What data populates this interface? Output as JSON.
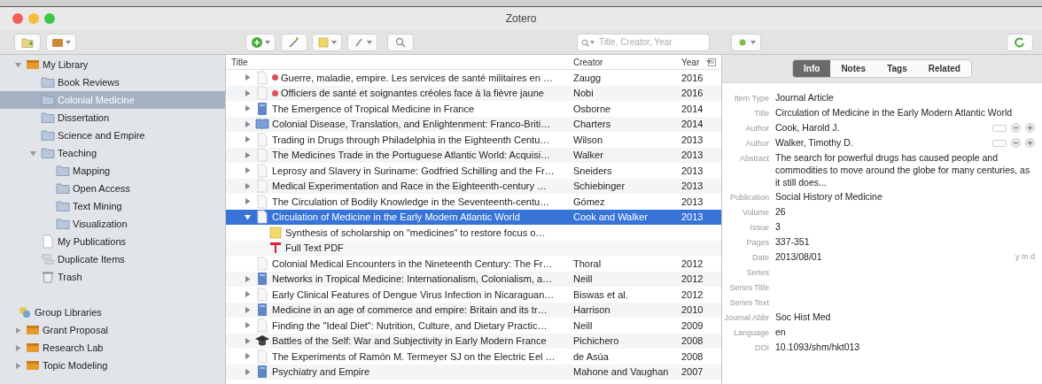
{
  "window": {
    "title": "Zotero"
  },
  "toolbar": {
    "search": {
      "placeholder": "Title, Creator, Year"
    }
  },
  "collections": [
    {
      "label": "My Library",
      "kind": "library",
      "expanded": true,
      "selected": false,
      "children": [
        {
          "label": "Book Reviews",
          "kind": "folder",
          "selected": false
        },
        {
          "label": "Colonial Medicine",
          "kind": "folder",
          "selected": true
        },
        {
          "label": "Dissertation",
          "kind": "folder",
          "selected": false
        },
        {
          "label": "Science and Empire",
          "kind": "folder",
          "selected": false
        },
        {
          "label": "Teaching",
          "kind": "folder",
          "selected": false,
          "expanded": true,
          "children": [
            {
              "label": "Mapping",
              "kind": "folder",
              "selected": false
            },
            {
              "label": "Open Access",
              "kind": "folder",
              "selected": false
            },
            {
              "label": "Text Mining",
              "kind": "folder",
              "selected": false
            },
            {
              "label": "Visualization",
              "kind": "folder",
              "selected": false
            }
          ]
        },
        {
          "label": "My Publications",
          "kind": "publications",
          "selected": false
        },
        {
          "label": "Duplicate Items",
          "kind": "duplicates",
          "selected": false
        },
        {
          "label": "Trash",
          "kind": "trash",
          "selected": false
        }
      ]
    }
  ],
  "group_libraries": {
    "label": "Group Libraries",
    "groups": [
      {
        "label": "Grant Proposal",
        "expanded": false
      },
      {
        "label": "Research Lab",
        "expanded": false
      },
      {
        "label": "Topic Modeling",
        "expanded": false
      }
    ]
  },
  "items_table": {
    "columns": [
      {
        "label": "Title",
        "sorted": false
      },
      {
        "label": "Creator",
        "sorted": false
      },
      {
        "label": "Year",
        "sorted": true
      }
    ],
    "rows": [
      {
        "kind": "article",
        "title": "Guerre, maladie, empire. Les services de santé militaires en …",
        "creator": "Zaugg",
        "year": "2016",
        "expandable": true,
        "selected": false,
        "color": "#e0505a"
      },
      {
        "kind": "article",
        "title": "Officiers de santé et soignantes créoles face à la fièvre jaune",
        "creator": "Nobi",
        "year": "2016",
        "expandable": true,
        "selected": false,
        "color": "#e0505a"
      },
      {
        "kind": "book",
        "title": "The Emergence of Tropical Medicine in France",
        "creator": "Osborne",
        "year": "2014",
        "expandable": true,
        "selected": false
      },
      {
        "kind": "book_section",
        "title": "Colonial Disease, Translation, and Enlightenment: Franco-Briti…",
        "creator": "Charters",
        "year": "2014",
        "expandable": true,
        "selected": false
      },
      {
        "kind": "article",
        "title": "Trading in Drugs through Philadelphia in the Eighteenth Centu…",
        "creator": "Wilson",
        "year": "2013",
        "expandable": true,
        "selected": false
      },
      {
        "kind": "article",
        "title": "The Medicines Trade in the Portuguese Atlantic World: Acquisi…",
        "creator": "Walker",
        "year": "2013",
        "expandable": true,
        "selected": false
      },
      {
        "kind": "article",
        "title": "Leprosy and Slavery in Suriname: Godfried Schilling and the Fr…",
        "creator": "Sneiders",
        "year": "2013",
        "expandable": true,
        "selected": false
      },
      {
        "kind": "article",
        "title": "Medical Experimentation and Race in the Eighteenth-century …",
        "creator": "Schiebinger",
        "year": "2013",
        "expandable": true,
        "selected": false
      },
      {
        "kind": "article",
        "title": "The Circulation of Bodily Knowledge in the Seventeenth-centu…",
        "creator": "Gómez",
        "year": "2013",
        "expandable": true,
        "selected": false
      },
      {
        "kind": "article",
        "title": "Circulation of Medicine in the Early Modern Atlantic World",
        "creator": "Cook and Walker",
        "year": "2013",
        "expandable": true,
        "expanded": true,
        "selected": true,
        "children": [
          {
            "kind": "note",
            "title": "Synthesis of scholarship on \"medicines\" to restore focus o…"
          },
          {
            "kind": "pdf",
            "title": "Full Text PDF"
          }
        ]
      },
      {
        "kind": "article",
        "title": "Colonial Medical Encounters in the Nineteenth Century: The Fr…",
        "creator": "Thoral",
        "year": "2012",
        "expandable": false,
        "selected": false
      },
      {
        "kind": "book",
        "title": "Networks in Tropical Medicine: Internationalism, Colonialism, a…",
        "creator": "Neill",
        "year": "2012",
        "expandable": true,
        "selected": false
      },
      {
        "kind": "article",
        "title": "Early Clinical Features of Dengue Virus Infection in Nicaraguan…",
        "creator": "Biswas et al.",
        "year": "2012",
        "expandable": true,
        "selected": false
      },
      {
        "kind": "book",
        "title": "Medicine in an age of commerce and empire: Britain and its tr…",
        "creator": "Harrison",
        "year": "2010",
        "expandable": true,
        "selected": false
      },
      {
        "kind": "article",
        "title": "Finding the \"Ideal Diet\": Nutrition, Culture, and Dietary Practic…",
        "creator": "Neill",
        "year": "2009",
        "expandable": true,
        "selected": false
      },
      {
        "kind": "thesis",
        "title": "Battles of the Self: War and Subjectivity in Early Modern France",
        "creator": "Pichichero",
        "year": "2008",
        "expandable": true,
        "selected": false
      },
      {
        "kind": "article",
        "title": "The Experiments of Ramón M. Termeyer SJ on the Electric Eel …",
        "creator": "de Asúa",
        "year": "2008",
        "expandable": true,
        "selected": false
      },
      {
        "kind": "book",
        "title": "Psychiatry and Empire",
        "creator": "Mahone and Vaughan",
        "year": "2007",
        "expandable": true,
        "selected": false
      }
    ]
  },
  "item_pane": {
    "tabs": [
      {
        "label": "Info",
        "selected": true
      },
      {
        "label": "Notes",
        "selected": false
      },
      {
        "label": "Tags",
        "selected": false
      },
      {
        "label": "Related",
        "selected": false
      }
    ],
    "fields": [
      {
        "kind": "text",
        "label": "Item Type",
        "value": "Journal Article"
      },
      {
        "kind": "text",
        "label": "Title",
        "value": "Circulation of Medicine in the Early Modern Atlantic World"
      },
      {
        "kind": "creator",
        "label": "Author",
        "value": "Cook, Harold J."
      },
      {
        "kind": "creator",
        "label": "Author",
        "value": "Walker, Timothy D."
      },
      {
        "kind": "text",
        "label": "Abstract",
        "value": "The search for powerful drugs has caused people and commodities to move around the globe for many centuries, as it still does..."
      },
      {
        "kind": "text",
        "label": "Publication",
        "value": "Social History of Medicine"
      },
      {
        "kind": "text",
        "label": "Volume",
        "value": "26"
      },
      {
        "kind": "text",
        "label": "Issue",
        "value": "3"
      },
      {
        "kind": "text",
        "label": "Pages",
        "value": "337-351"
      },
      {
        "kind": "date",
        "label": "Date",
        "value": "2013/08/01",
        "hint": "y m d"
      },
      {
        "kind": "text",
        "label": "Series"
      },
      {
        "kind": "text",
        "label": "Series Title"
      },
      {
        "kind": "text",
        "label": "Series Text"
      },
      {
        "kind": "text",
        "label": "Journal Abbr",
        "value": "Soc Hist Med"
      },
      {
        "kind": "text",
        "label": "Language",
        "value": "en"
      },
      {
        "kind": "text",
        "label": "DOI",
        "value": "10.1093/shm/hkt013"
      }
    ]
  }
}
